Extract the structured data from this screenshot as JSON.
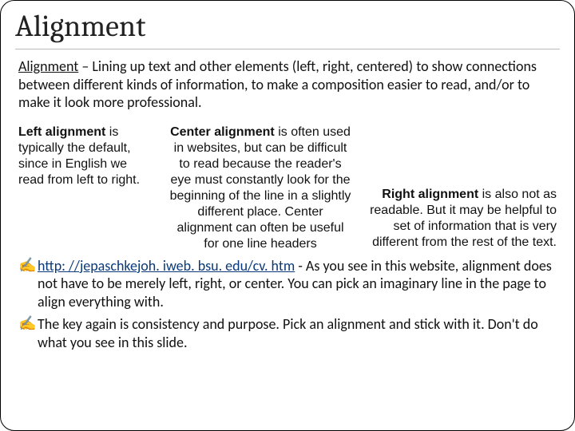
{
  "title": "Alignment",
  "definition": {
    "term": "Alignment",
    "rest": " – Lining up text and other elements (left, right, centered) to show connections between different kinds of information, to make a composition easier to read, and/or to make it look more professional."
  },
  "columns": {
    "left": {
      "bold": "Left alignment",
      "rest": " is typically the default, since in English we read from left to right."
    },
    "center": {
      "bold": "Center alignment",
      "rest": " is often used in websites, but can be difficult to read because the reader's eye must constantly look for the beginning of the line in a slightly different place. Center alignment can often be useful for one line headers"
    },
    "right": {
      "bold": "Right alignment",
      "rest": " is also not as readable. But it may be helpful to set of information that is very different from the rest of the text."
    }
  },
  "bullets": [
    {
      "link": "http: //jepaschkejoh. iweb. bsu. edu/cv. htm",
      "rest": "  - As you see in this website, alignment does not have to be merely left, right, or center.  You can pick an imaginary line in the page to align everything with."
    },
    {
      "text": "The key again is consistency and purpose.  Pick an alignment and stick with it.  Don't do what you see in this slide."
    }
  ],
  "icons": {
    "bullet_marker": "✍"
  }
}
